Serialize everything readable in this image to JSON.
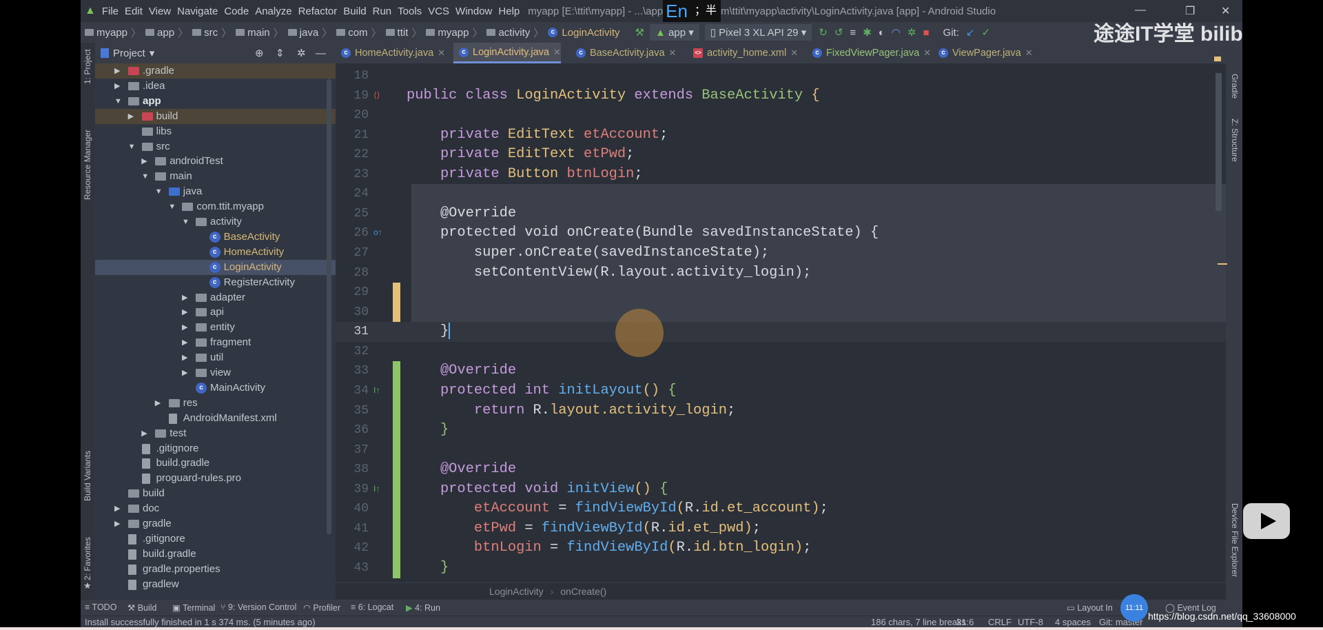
{
  "titlebar": {
    "menu": [
      "File",
      "Edit",
      "View",
      "Navigate",
      "Code",
      "Analyze",
      "Refactor",
      "Build",
      "Run",
      "Tools",
      "VCS",
      "Window",
      "Help"
    ],
    "title_left": "myapp [E:\\ttit\\myapp] - ...\\app",
    "ime_lang": "En",
    "ime_mode": "；半",
    "title_right": "m\\ttit\\myapp\\activity\\LoginActivity.java [app] - Android Studio"
  },
  "navbar": {
    "crumbs": [
      "myapp",
      "app",
      "src",
      "main",
      "java",
      "com",
      "ttit",
      "myapp",
      "activity",
      "LoginActivity"
    ],
    "run_config": "app",
    "device": "Pixel 3 XL API 29",
    "git_label": "Git:"
  },
  "project_panel": {
    "title": "Project",
    "tree": [
      {
        "label": ".gradle",
        "level": 0,
        "arrow": "collapsed",
        "icon": "red",
        "hl": true
      },
      {
        "label": ".idea",
        "level": 0,
        "arrow": "collapsed",
        "icon": "folder"
      },
      {
        "label": "app",
        "level": 0,
        "arrow": "expanded",
        "icon": "folder",
        "bold": true
      },
      {
        "label": "build",
        "level": 1,
        "arrow": "collapsed",
        "icon": "red",
        "hl": true
      },
      {
        "label": "libs",
        "level": 1,
        "icon": "folder"
      },
      {
        "label": "src",
        "level": 1,
        "arrow": "expanded",
        "icon": "folder"
      },
      {
        "label": "androidTest",
        "level": 2,
        "arrow": "collapsed",
        "icon": "folder"
      },
      {
        "label": "main",
        "level": 2,
        "arrow": "expanded",
        "icon": "folder"
      },
      {
        "label": "java",
        "level": 3,
        "arrow": "expanded",
        "icon": "blue"
      },
      {
        "label": "com.ttit.myapp",
        "level": 4,
        "arrow": "expanded",
        "icon": "folder"
      },
      {
        "label": "activity",
        "level": 5,
        "arrow": "expanded",
        "icon": "folder"
      },
      {
        "label": "BaseActivity",
        "level": 6,
        "icon": "cls",
        "cls": true
      },
      {
        "label": "HomeActivity",
        "level": 6,
        "icon": "cls",
        "cls": true
      },
      {
        "label": "LoginActivity",
        "level": 6,
        "icon": "cls",
        "cls": true,
        "selected": true
      },
      {
        "label": "RegisterActivity",
        "level": 6,
        "icon": "cls"
      },
      {
        "label": "adapter",
        "level": 5,
        "arrow": "collapsed",
        "icon": "folder"
      },
      {
        "label": "api",
        "level": 5,
        "arrow": "collapsed",
        "icon": "folder"
      },
      {
        "label": "entity",
        "level": 5,
        "arrow": "collapsed",
        "icon": "folder"
      },
      {
        "label": "fragment",
        "level": 5,
        "arrow": "collapsed",
        "icon": "folder"
      },
      {
        "label": "util",
        "level": 5,
        "arrow": "collapsed",
        "icon": "folder"
      },
      {
        "label": "view",
        "level": 5,
        "arrow": "collapsed",
        "icon": "folder"
      },
      {
        "label": "MainActivity",
        "level": 5,
        "icon": "cls"
      },
      {
        "label": "res",
        "level": 3,
        "arrow": "collapsed",
        "icon": "folder"
      },
      {
        "label": "AndroidManifest.xml",
        "level": 3,
        "icon": "file"
      },
      {
        "label": "test",
        "level": 2,
        "arrow": "collapsed",
        "icon": "folder"
      },
      {
        "label": ".gitignore",
        "level": 1,
        "icon": "file"
      },
      {
        "label": "build.gradle",
        "level": 1,
        "icon": "file"
      },
      {
        "label": "proguard-rules.pro",
        "level": 1,
        "icon": "file"
      },
      {
        "label": "build",
        "level": 0,
        "icon": "folder"
      },
      {
        "label": "doc",
        "level": 0,
        "arrow": "collapsed",
        "icon": "folder"
      },
      {
        "label": "gradle",
        "level": 0,
        "arrow": "collapsed",
        "icon": "folder"
      },
      {
        "label": ".gitignore",
        "level": 0,
        "icon": "file"
      },
      {
        "label": "build.gradle",
        "level": 0,
        "icon": "file"
      },
      {
        "label": "gradle.properties",
        "level": 0,
        "icon": "file"
      },
      {
        "label": "gradlew",
        "level": 0,
        "icon": "file"
      }
    ]
  },
  "tabs": [
    {
      "label": "HomeActivity.java",
      "icon": "class-icon"
    },
    {
      "label": "LoginActivity.java",
      "icon": "class-icon",
      "active": true
    },
    {
      "label": "BaseActivity.java",
      "icon": "class-icon"
    },
    {
      "label": "activity_home.xml",
      "icon": "xml-icon"
    },
    {
      "label": "FixedViewPager.java",
      "icon": "class-icon"
    },
    {
      "label": "ViewPager.java",
      "icon": "class-icon"
    }
  ],
  "left_strip": [
    "1: Project",
    "Resource Manager",
    "Build Variants",
    "2: Favorites"
  ],
  "right_strip": [
    "Gradle",
    "Z: Structure",
    "Device File Explorer"
  ],
  "editor": {
    "first_line": 18,
    "lines": [
      [],
      [
        [
          "public ",
          "kw"
        ],
        [
          "class ",
          "kw"
        ],
        [
          "LoginActivity ",
          "ty"
        ],
        [
          "extends ",
          "kw"
        ],
        [
          "BaseActivity ",
          "sup"
        ],
        [
          "{",
          "br"
        ]
      ],
      [],
      [
        [
          "    private ",
          "kw"
        ],
        [
          "EditText ",
          "ty"
        ],
        [
          "etAccount",
          "fd"
        ],
        [
          ";",
          "df"
        ]
      ],
      [
        [
          "    private ",
          "kw"
        ],
        [
          "EditText ",
          "ty"
        ],
        [
          "etPwd",
          "fd"
        ],
        [
          ";",
          "df"
        ]
      ],
      [
        [
          "    private ",
          "kw"
        ],
        [
          "Button ",
          "ty"
        ],
        [
          "btnLogin",
          "fd"
        ],
        [
          ";",
          "df"
        ]
      ],
      [],
      [
        [
          "    @Override",
          "an"
        ]
      ],
      [
        [
          "    protected void onCreate(Bundle savedInstanceState) {",
          "df"
        ]
      ],
      [
        [
          "        super.onCreate(savedInstanceState);",
          "df"
        ]
      ],
      [
        [
          "        setContentView(R.layout.activity_login);",
          "df"
        ]
      ],
      [],
      [],
      [
        [
          "    }",
          "df"
        ]
      ],
      [],
      [
        [
          "    @Override",
          "kw"
        ]
      ],
      [
        [
          "    protected ",
          "kw"
        ],
        [
          "int ",
          "kw"
        ],
        [
          "initLayout",
          "fn"
        ],
        [
          "() ",
          "br"
        ],
        [
          "{",
          "br2"
        ]
      ],
      [
        [
          "        return ",
          "kw"
        ],
        [
          "R.",
          "df"
        ],
        [
          "layout.activity_login",
          "id"
        ],
        [
          ";",
          "df"
        ]
      ],
      [
        [
          "    }",
          "br2"
        ]
      ],
      [],
      [
        [
          "    @Override",
          "kw"
        ]
      ],
      [
        [
          "    protected ",
          "kw"
        ],
        [
          "void ",
          "kw"
        ],
        [
          "initView",
          "fn"
        ],
        [
          "() ",
          "br"
        ],
        [
          "{",
          "br2"
        ]
      ],
      [
        [
          "        etAccount",
          "fd"
        ],
        [
          " = ",
          "df"
        ],
        [
          "findViewById",
          "fn"
        ],
        [
          "(",
          "br"
        ],
        [
          "R.",
          "df"
        ],
        [
          "id.et_account",
          "id"
        ],
        [
          ")",
          "br"
        ],
        [
          ";",
          "df"
        ]
      ],
      [
        [
          "        etPwd",
          "fd"
        ],
        [
          " = ",
          "df"
        ],
        [
          "findViewById",
          "fn"
        ],
        [
          "(",
          "br"
        ],
        [
          "R.",
          "df"
        ],
        [
          "id.et_pwd",
          "id"
        ],
        [
          ")",
          "br"
        ],
        [
          ";",
          "df"
        ]
      ],
      [
        [
          "        btnLogin",
          "fd"
        ],
        [
          " = ",
          "df"
        ],
        [
          "findViewById",
          "fn"
        ],
        [
          "(",
          "br"
        ],
        [
          "R.",
          "df"
        ],
        [
          "id.btn_login",
          "id"
        ],
        [
          ")",
          "br"
        ],
        [
          ";",
          "df"
        ]
      ],
      [
        [
          "    }",
          "br2"
        ]
      ]
    ],
    "breadcrumb": [
      "LoginActivity",
      "onCreate()"
    ]
  },
  "bottom_tools": [
    "TODO",
    "Build",
    "Terminal",
    "9: Version Control",
    "Profiler",
    "6: Logcat",
    "4: Run"
  ],
  "bottom_right_tools": [
    "Layout In",
    "Event Log"
  ],
  "status": {
    "message": "Install successfully finished in 1 s 374 ms. (5 minutes ago)",
    "selection": "186 chars, 7 line breaks",
    "position": "31:6",
    "line_sep": "CRLF",
    "encoding": "UTF-8",
    "indent": "4 spaces",
    "git": "Git: master"
  },
  "overlay": {
    "watermark": "途途IT学堂 bilibili",
    "clock": "11:11",
    "csdn": "https://blog.csdn.net/qq_33608000"
  }
}
